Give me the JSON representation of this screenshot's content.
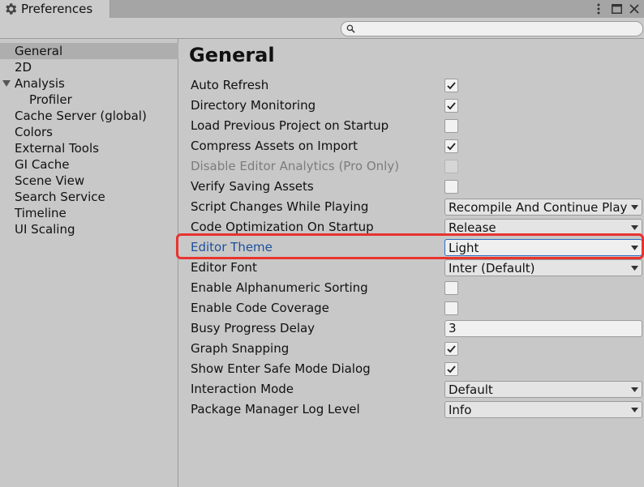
{
  "window": {
    "tab_title": "Preferences",
    "search": {
      "value": "",
      "placeholder": ""
    }
  },
  "sidebar": {
    "items": [
      {
        "label": "General",
        "selected": true,
        "indent": 0
      },
      {
        "label": "2D",
        "indent": 0
      },
      {
        "label": "Analysis",
        "expanded": true,
        "indent": 0
      },
      {
        "label": "Profiler",
        "indent": 1
      },
      {
        "label": "Cache Server (global)",
        "indent": 0
      },
      {
        "label": "Colors",
        "indent": 0
      },
      {
        "label": "External Tools",
        "indent": 0
      },
      {
        "label": "GI Cache",
        "indent": 0
      },
      {
        "label": "Scene View",
        "indent": 0
      },
      {
        "label": "Search Service",
        "indent": 0
      },
      {
        "label": "Timeline",
        "indent": 0
      },
      {
        "label": "UI Scaling",
        "indent": 0
      }
    ]
  },
  "main": {
    "title": "General",
    "settings": [
      {
        "label": "Auto Refresh",
        "type": "checkbox",
        "checked": true
      },
      {
        "label": "Directory Monitoring",
        "type": "checkbox",
        "checked": true
      },
      {
        "label": "Load Previous Project on Startup",
        "type": "checkbox",
        "checked": false
      },
      {
        "label": "Compress Assets on Import",
        "type": "checkbox",
        "checked": true
      },
      {
        "label": "Disable Editor Analytics (Pro Only)",
        "type": "checkbox",
        "checked": false,
        "disabled": true
      },
      {
        "label": "Verify Saving Assets",
        "type": "checkbox",
        "checked": false
      },
      {
        "label": "Script Changes While Playing",
        "type": "dropdown",
        "value": "Recompile And Continue Playing"
      },
      {
        "label": "Code Optimization On Startup",
        "type": "dropdown",
        "value": "Release"
      },
      {
        "label": "Editor Theme",
        "type": "dropdown",
        "value": "Light",
        "highlighted": true
      },
      {
        "label": "Editor Font",
        "type": "dropdown",
        "value": "Inter (Default)"
      },
      {
        "label": "Enable Alphanumeric Sorting",
        "type": "checkbox",
        "checked": false
      },
      {
        "label": "Enable Code Coverage",
        "type": "checkbox",
        "checked": false
      },
      {
        "label": "Busy Progress Delay",
        "type": "text",
        "value": "3"
      },
      {
        "label": "Graph Snapping",
        "type": "checkbox",
        "checked": true
      },
      {
        "label": "Show Enter Safe Mode Dialog",
        "type": "checkbox",
        "checked": true
      },
      {
        "label": "Interaction Mode",
        "type": "dropdown",
        "value": "Default"
      },
      {
        "label": "Package Manager Log Level",
        "type": "dropdown",
        "value": "Info"
      }
    ]
  },
  "colors": {
    "highlight": "#e8332e",
    "accent_label": "#1c4f9c",
    "selected_row": "#aeaeae"
  },
  "icons": {
    "tab": "gear-icon",
    "menu": "kebab-menu-icon",
    "maximize": "maximize-icon",
    "close": "close-icon",
    "search": "search-icon",
    "foldout": "triangle-down-icon",
    "check": "checkmark-icon",
    "dropdown": "dropdown-arrow-icon"
  }
}
